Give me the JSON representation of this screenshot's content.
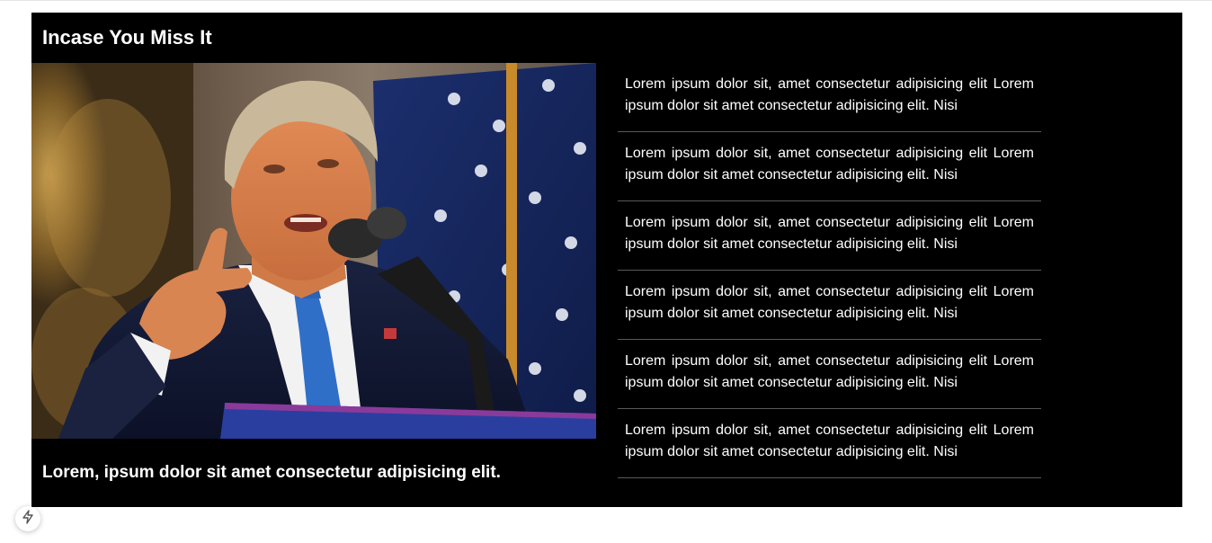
{
  "section": {
    "title": "Incase You Miss It"
  },
  "feature": {
    "image_alt": "Speaker at podium with microphone in front of flag",
    "caption": "Lorem, ipsum dolor sit amet consectetur adipisicing elit."
  },
  "news": {
    "items": [
      {
        "text": "Lorem ipsum dolor sit, amet consectetur adipisicing elit Lorem ipsum dolor sit amet consectetur adipisicing elit. Nisi"
      },
      {
        "text": "Lorem ipsum dolor sit, amet consectetur adipisicing elit Lorem ipsum dolor sit amet consectetur adipisicing elit. Nisi"
      },
      {
        "text": "Lorem ipsum dolor sit, amet consectetur adipisicing elit Lorem ipsum dolor sit amet consectetur adipisicing elit. Nisi"
      },
      {
        "text": "Lorem ipsum dolor sit, amet consectetur adipisicing elit Lorem ipsum dolor sit amet consectetur adipisicing elit. Nisi"
      },
      {
        "text": "Lorem ipsum dolor sit, amet consectetur adipisicing elit Lorem ipsum dolor sit amet consectetur adipisicing elit. Nisi"
      },
      {
        "text": "Lorem ipsum dolor sit, amet consectetur adipisicing elit Lorem ipsum dolor sit amet consectetur adipisicing elit. Nisi"
      }
    ]
  },
  "dev_indicator": {
    "icon": "lightning-bolt-icon"
  },
  "colors": {
    "background": "#000000",
    "text": "#ffffff",
    "divider": "#5a5a5a"
  }
}
